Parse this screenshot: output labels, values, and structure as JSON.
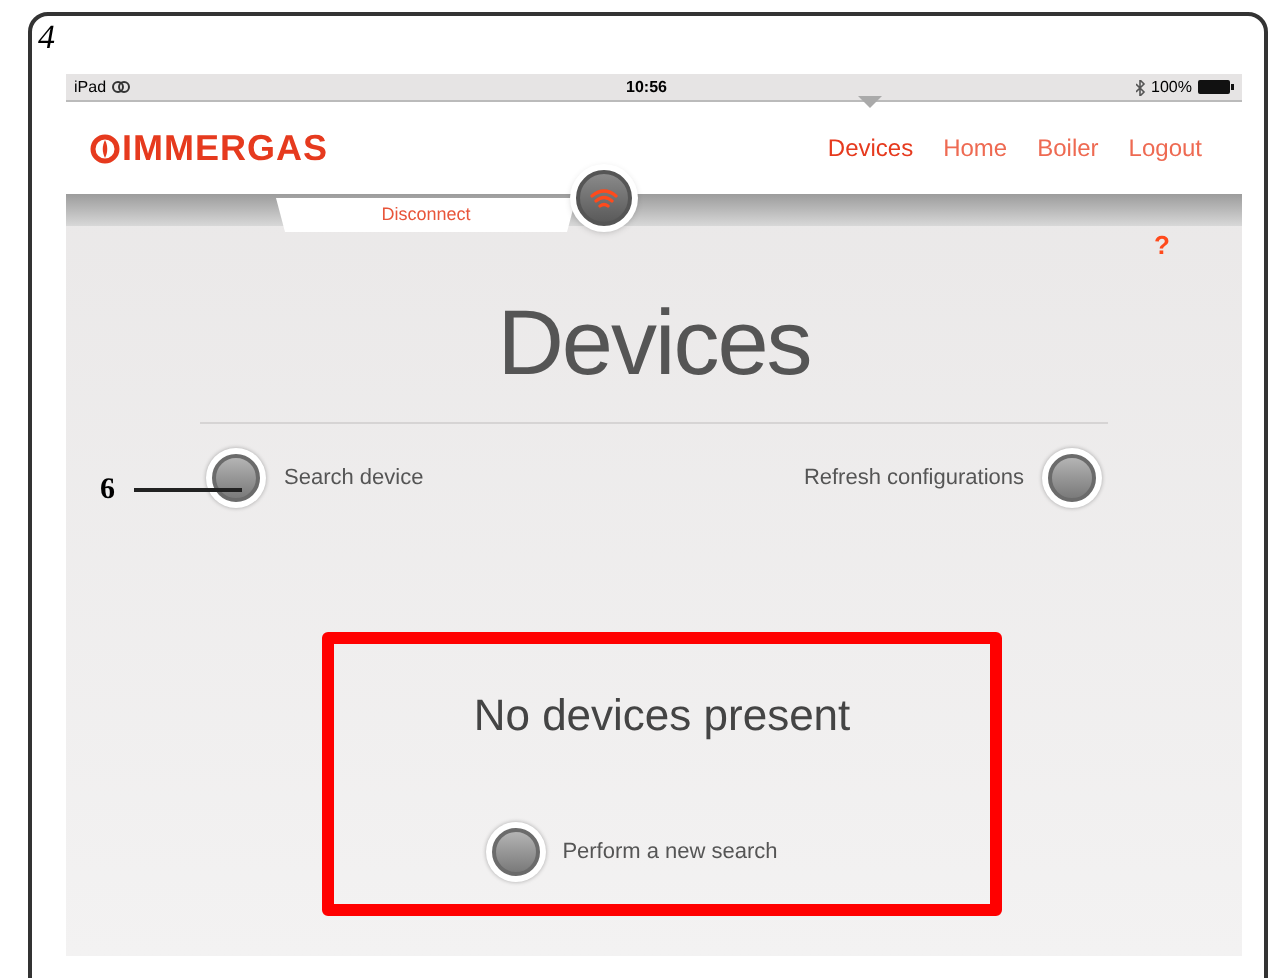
{
  "figure_number": "4",
  "status_bar": {
    "device": "iPad",
    "time": "10:56",
    "battery": "100%"
  },
  "header": {
    "logo": "IMMERGAS",
    "nav": [
      {
        "label": "Devices",
        "selected": true
      },
      {
        "label": "Home",
        "selected": false
      },
      {
        "label": "Boiler",
        "selected": false
      },
      {
        "label": "Logout",
        "selected": false
      }
    ]
  },
  "disconnect": "Disconnect",
  "help": "?",
  "title": "Devices",
  "actions": [
    {
      "label": "Search device",
      "kind": "leading"
    },
    {
      "label": "Refresh configurations",
      "kind": "trailing"
    }
  ],
  "empty_state": {
    "message": "No devices present",
    "action": "Perform a new search"
  },
  "callout": "6"
}
